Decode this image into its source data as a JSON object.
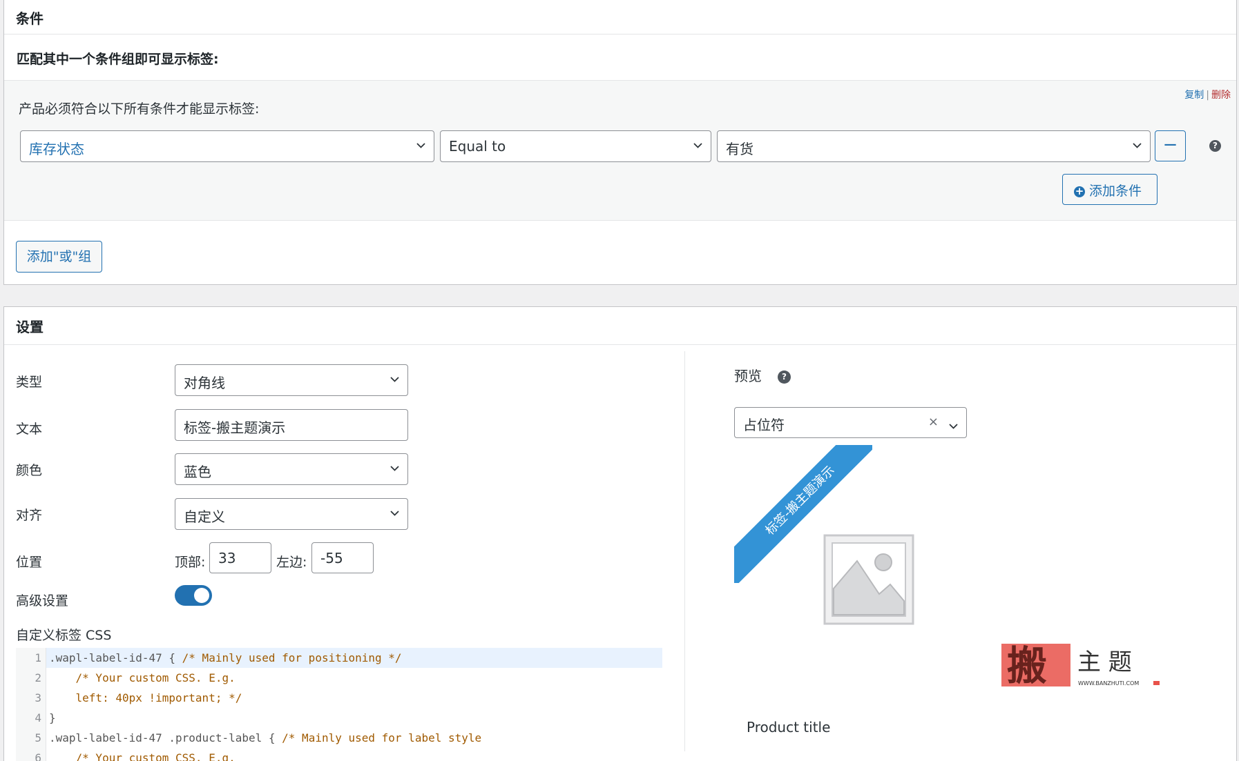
{
  "conditions": {
    "title": "条件",
    "subtitle": "匹配其中一个条件组即可显示标签:",
    "group": {
      "description": "产品必须符合以下所有条件才能显示标签:",
      "copy_link": "复制",
      "separator": "|",
      "delete_link": "删除",
      "rule": {
        "field": "库存状态",
        "operator": "Equal to",
        "value": "有货"
      },
      "remove_label": "−",
      "help": "?",
      "add_condition_label": "添加条件"
    },
    "add_or_group_label": "添加\"或\"组"
  },
  "settings": {
    "title": "设置",
    "type": {
      "label": "类型",
      "value": "对角线"
    },
    "text": {
      "label": "文本",
      "value": "标签-搬主题演示"
    },
    "color": {
      "label": "颜色",
      "value": "蓝色"
    },
    "align": {
      "label": "对齐",
      "value": "自定义"
    },
    "position": {
      "label": "位置",
      "top_label": "顶部:",
      "top_value": "33",
      "left_label": "左边:",
      "left_value": "-55"
    },
    "advanced": {
      "label": "高级设置",
      "enabled": true
    },
    "custom_css": {
      "label": "自定义标签 CSS",
      "lines": [
        {
          "n": "1",
          "tokens": [
            [
              "sel",
              ".wapl-label-id-47 { "
            ],
            [
              "cm",
              "/* Mainly used for positioning */"
            ]
          ]
        },
        {
          "n": "2",
          "tokens": [
            [
              "cm",
              "    /* Your custom CSS. E.g."
            ]
          ]
        },
        {
          "n": "3",
          "tokens": [
            [
              "cm",
              "    left: 40px !important; */"
            ]
          ]
        },
        {
          "n": "4",
          "tokens": [
            [
              "sel",
              "}"
            ]
          ]
        },
        {
          "n": "5",
          "tokens": [
            [
              "sel",
              ".wapl-label-id-47 .product-label { "
            ],
            [
              "cm",
              "/* Mainly used for label style"
            ]
          ]
        },
        {
          "n": "6",
          "tokens": [
            [
              "cm",
              "    /* Your custom CSS. E.g."
            ]
          ]
        }
      ]
    }
  },
  "preview": {
    "label": "预览",
    "help": "?",
    "product_select": "占位符",
    "clear": "×",
    "ribbon_text": "标签-搬主题演示",
    "product_title": "Product title"
  },
  "colors": {
    "accent": "#2271b1",
    "ribbon": "#3393d6",
    "delete": "#b32d2e"
  },
  "watermark": {
    "glyph": "搬",
    "text": "主 题",
    "url": "WWW.BANZHUTI.COM"
  }
}
